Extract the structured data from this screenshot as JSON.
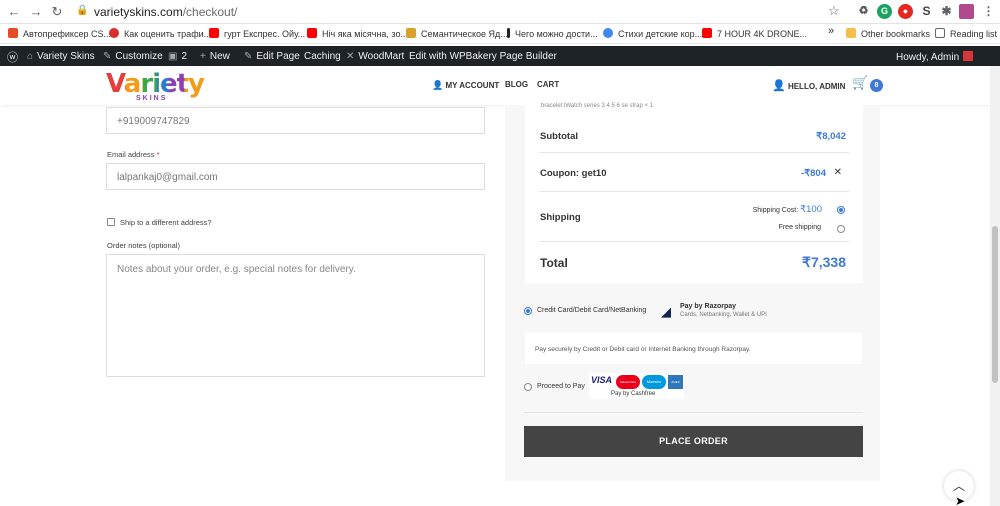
{
  "browser": {
    "url_host": "varietyskins.com",
    "url_path": "/checkout/",
    "bookmarks": [
      "Автопрефиксер CS...",
      "Как оценить трафи...",
      "гурт Експрес. Ойу...",
      "Ніч яка місячна, зо...",
      "Семантическое Яд...",
      "Чего можно дости...",
      "Стихи детские кор...",
      "7 HOUR 4K DRONE..."
    ],
    "more_bookmarks": "»",
    "other_bookmarks": "Other bookmarks",
    "reading_list": "Reading list"
  },
  "wpbar": {
    "site_name": "Variety Skins",
    "customize": "Customize",
    "comments_count": "2",
    "new": "New",
    "edit_page": "Edit Page",
    "caching": "Caching",
    "woodmart": "WoodMart",
    "wpbakery": "Edit with WPBakery Page Builder",
    "howdy": "Howdy, Admin"
  },
  "header": {
    "logo_word": "Variety",
    "logo_sub": "SKINS",
    "nav": [
      "MY ACCOUNT",
      "BLOG",
      "CART"
    ],
    "hello": "HELLO, ADMIN",
    "cart_count": "8"
  },
  "form": {
    "phone_value": "+919009747829",
    "email_label": "Email address",
    "email_required": "*",
    "email_value": "lalpankaj0@gmail.com",
    "ship_different": "Ship to a different address?",
    "notes_label": "Order notes (optional)",
    "notes_placeholder": "Notes about your order, e.g. special notes for delivery."
  },
  "order": {
    "item_line": "bracelet iWatch series 3 4 5 6 se strap  × 1",
    "subtotal_label": "Subtotal",
    "subtotal_value": "₹8,042",
    "coupon_label": "Coupon: get10",
    "coupon_value": "-₹804",
    "coupon_remove": "✕",
    "shipping_label": "Shipping",
    "shipping_cost_label": "Shipping Cost:",
    "shipping_cost_value": "₹100",
    "free_shipping": "Free shipping",
    "total_label": "Total",
    "total_value": "₹7,338"
  },
  "payment": {
    "option1": "Credit Card/Debit Card/NetBanking",
    "razorpay_title": "Pay by Razorpay",
    "razorpay_sub": "Cards, Netbanking, Wallet & UPI",
    "description": "Pay securely by Credit or Debit card or Internet Banking through Razorpay.",
    "option2": "Proceed to Pay",
    "cards_caption": "Pay by Cashfree",
    "card_visa": "VISA",
    "card_mc": "MasterCard",
    "card_maestro": "Maestro",
    "card_amex": "AMEX",
    "place_order": "PLACE ORDER"
  }
}
